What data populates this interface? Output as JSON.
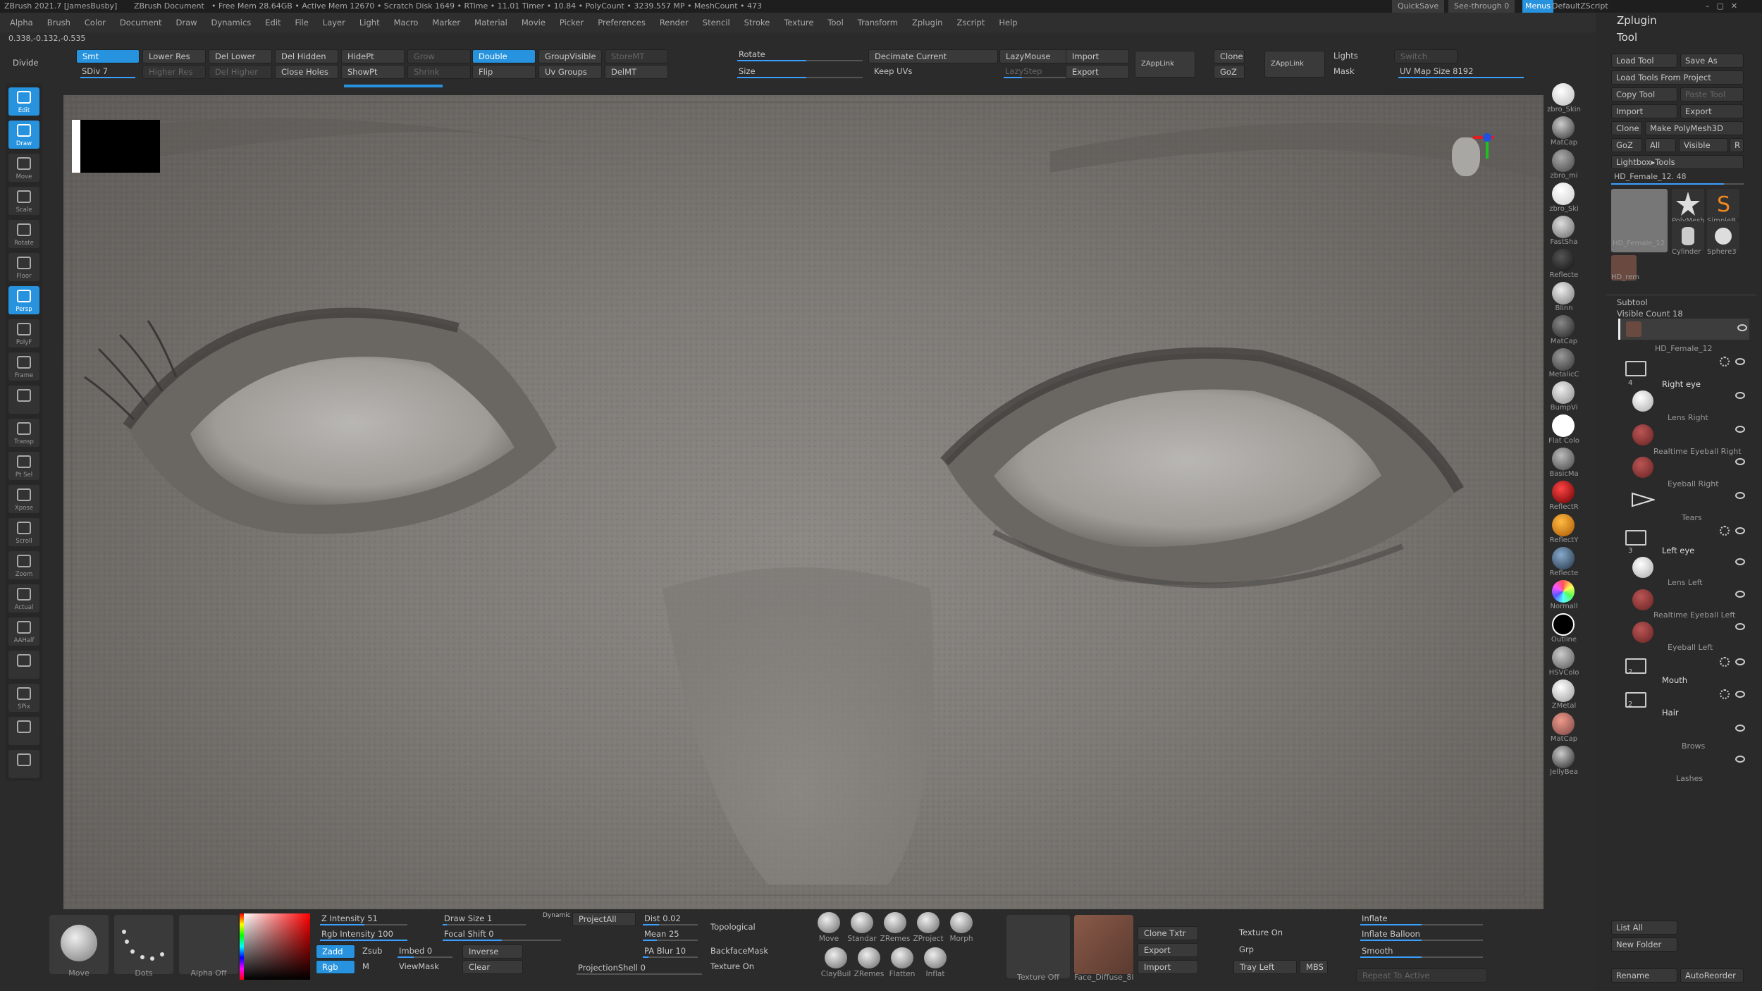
{
  "titlebar": {
    "app": "ZBrush 2021.7 [JamesBusby]",
    "doc": "ZBrush Document",
    "stats": "• Free Mem 28.64GB • Active Mem 12670 • Scratch Disk 1649 • RTime • 11.01 Timer • 10.84 • PolyCount • 3239.557 MP • MeshCount • 473",
    "quicksave": "QuickSave",
    "seethrough": "See-through 0",
    "menus": "Menus",
    "script": "DefaultZScript"
  },
  "menus": [
    "Alpha",
    "Brush",
    "Color",
    "Document",
    "Draw",
    "Dynamics",
    "Edit",
    "File",
    "Layer",
    "Light",
    "Macro",
    "Marker",
    "Material",
    "Movie",
    "Picker",
    "Preferences",
    "Render",
    "Stencil",
    "Stroke",
    "Texture",
    "Tool",
    "Transform",
    "Zplugin",
    "Zscript",
    "Help"
  ],
  "coords": "0.338,-0.132,-0.535",
  "toolbar": {
    "divide": "Divide",
    "smt": "Smt",
    "sdiv": "SDiv 7",
    "lower_res": "Lower Res",
    "higher_res": "Higher Res",
    "del_lower": "Del Lower",
    "del_higher": "Del Higher",
    "del_hidden": "Del Hidden",
    "close_holes": "Close Holes",
    "hide_pt": "HidePt",
    "show_pt": "ShowPt",
    "grow": "Grow",
    "shrink": "Shrink",
    "double": "Double",
    "flip": "Flip",
    "group_visible": "GroupVisible",
    "uv_groups": "Uv Groups",
    "store_mt": "StoreMT",
    "del_mt": "DelMT",
    "rotate": "Rotate",
    "size": "Size",
    "decimate_current": "Decimate Current",
    "keep_uvs": "Keep UVs",
    "lazymouse": "LazyMouse",
    "lazystep": "LazyStep",
    "import": "Import",
    "export": "Export",
    "zapplink": "ZAppLink",
    "clone": "Clone",
    "goz": "GoZ",
    "zapplink2": "ZAppLink",
    "lights": "Lights",
    "mask": "Mask",
    "switch": "Switch",
    "uv_map_size": "UV Map Size 8192"
  },
  "left_tools": [
    "Edit",
    "Draw",
    "Move",
    "Scale",
    "Rotate",
    "Floor",
    "Persp",
    "PolyF",
    "Frame",
    "",
    "Transp",
    "Pt Sel",
    "Xpose",
    "Scroll",
    "Zoom",
    "Actual",
    "AAHalf",
    "",
    "SPix",
    "",
    ""
  ],
  "materials": [
    "zbro_Skin",
    "MatCap",
    "zbro_mi",
    "zbro_Ski",
    "FastSha",
    "Reflecte",
    "Blinn",
    "MatCap",
    "MetalicC",
    "BumpVi",
    "Flat Colo",
    "BasicMa",
    "ReflectR",
    "ReflectY",
    "Reflecte",
    "Normall",
    "Outline",
    "HSVColo",
    "ZMetal",
    "MatCap",
    "JellyBea"
  ],
  "rightpanel": {
    "zplugin": "Zplugin",
    "tool": "Tool",
    "load_tool": "Load Tool",
    "save_as": "Save As",
    "load_from_project": "Load Tools From Project",
    "copy_tool": "Copy Tool",
    "paste_tool": "Paste Tool",
    "import": "Import",
    "export": "Export",
    "clone": "Clone",
    "make_polymesh": "Make PolyMesh3D",
    "goz": "GoZ",
    "all": "All",
    "visible": "Visible",
    "r": "R",
    "lightbox_tools": "Lightbox▸Tools",
    "current_tool": "HD_Female_12. 48",
    "thumb_names": [
      "HD_Female_12",
      "PolyMesh",
      "SimpleB",
      "Cylinder",
      "Sphere3"
    ],
    "hd_rem": "HD_rem",
    "subtool": "Subtool",
    "visible_count": "Visible Count 18",
    "list_all": "List All",
    "new_folder": "New Folder",
    "rename": "Rename",
    "autoreorder": "AutoReorder"
  },
  "subtools": {
    "main": "HD_Female_12",
    "folder1": {
      "count": "4",
      "name": "Right eye",
      "items": [
        "Lens Right",
        "Realtime Eyeball Right",
        "Eyeball Right",
        "Tears"
      ]
    },
    "folder2": {
      "count": "3",
      "name": "Left eye",
      "items": [
        "Lens Left",
        "Realtime Eyeball Left",
        "Eyeball Left"
      ]
    },
    "folder3": {
      "count": "2",
      "name": "Mouth"
    },
    "folder4": {
      "count": "2",
      "name": "Hair",
      "items": [
        "Brows",
        "Lashes"
      ]
    }
  },
  "bottombar": {
    "brush": "Move",
    "stroke": "Dots",
    "alpha": "Alpha Off",
    "z_intensity": "Z Intensity 51",
    "rgb_intensity": "Rgb Intensity 100",
    "zadd": "Zadd",
    "zsub": "Zsub",
    "rgb": "Rgb",
    "m": "M",
    "draw_size": "Draw Size 1",
    "dynamic": "Dynamic",
    "focal_shift": "Focal Shift 0",
    "imbed": "Imbed 0",
    "inverse": "Inverse",
    "viewmask": "ViewMask",
    "clear": "Clear",
    "project_all": "ProjectAll",
    "dist": "Dist 0.02",
    "mean": "Mean 25",
    "pa_blur": "PA Blur 10",
    "projection_shell": "ProjectionShell 0",
    "topological": "Topological",
    "backface_mask": "BackfaceMask",
    "texture_on": "Texture On",
    "brushes": [
      "Move",
      "Standar",
      "ZRemes",
      "ZProject",
      "Morph",
      "ClayBuil",
      "ZRemes",
      "Flatten",
      "Inflat"
    ],
    "texture_off": "Texture Off",
    "face_diffuse": "Face_Diffuse_8k",
    "clone_txtr": "Clone Txtr",
    "export": "Export",
    "import": "Import",
    "texture_on2": "Texture On",
    "grp": "Grp",
    "tray_left": "Tray Left",
    "mbs": "MBS",
    "inflate": "Inflate",
    "inflate_balloon": "Inflate Balloon",
    "smooth": "Smooth",
    "repeat_active": "Repeat To Active"
  },
  "colors": {
    "accent": "#2792dd",
    "panel": "#2b2b2b",
    "viewport": "#807d79"
  }
}
